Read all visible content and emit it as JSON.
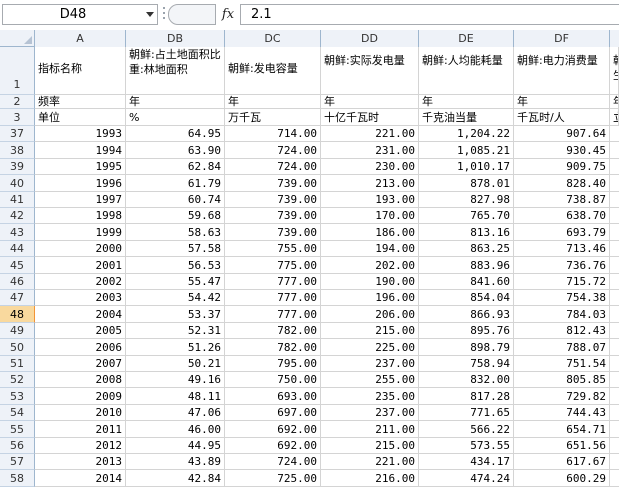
{
  "formula_bar": {
    "cell_ref": "D48",
    "fx_label": "fx",
    "content": "2.1"
  },
  "columns": [
    "A",
    "DB",
    "DC",
    "DD",
    "DE",
    "DF"
  ],
  "header_rows": {
    "row1": {
      "num": "1",
      "A": "指标名称",
      "DB": "朝鲜:占土地面积比重:林地面积",
      "DC": "朝鲜:发电容量",
      "DD": "朝鲜:实际发电量",
      "DE": "朝鲜:人均能耗量",
      "DF": "朝鲜:电力消费量",
      "DG": "朝生"
    },
    "row2": {
      "num": "2",
      "A": "频率",
      "DB": "年",
      "DC": "年",
      "DD": "年",
      "DE": "年",
      "DF": "年",
      "DG": "年"
    },
    "row3": {
      "num": "3",
      "A": "单位",
      "DB": "%",
      "DC": "万千瓦",
      "DD": "十亿千瓦时",
      "DE": "千克油当量",
      "DF": "千瓦时/人",
      "DG": "立"
    }
  },
  "data_rows": [
    {
      "num": "37",
      "A": "1993",
      "DB": "64.95",
      "DC": "714.00",
      "DD": "221.00",
      "DE": "1,204.22",
      "DF": "907.64"
    },
    {
      "num": "38",
      "A": "1994",
      "DB": "63.90",
      "DC": "724.00",
      "DD": "231.00",
      "DE": "1,085.21",
      "DF": "930.45"
    },
    {
      "num": "39",
      "A": "1995",
      "DB": "62.84",
      "DC": "724.00",
      "DD": "230.00",
      "DE": "1,010.17",
      "DF": "909.75"
    },
    {
      "num": "40",
      "A": "1996",
      "DB": "61.79",
      "DC": "739.00",
      "DD": "213.00",
      "DE": "878.01",
      "DF": "828.40"
    },
    {
      "num": "41",
      "A": "1997",
      "DB": "60.74",
      "DC": "739.00",
      "DD": "193.00",
      "DE": "827.98",
      "DF": "738.87"
    },
    {
      "num": "42",
      "A": "1998",
      "DB": "59.68",
      "DC": "739.00",
      "DD": "170.00",
      "DE": "765.70",
      "DF": "638.70"
    },
    {
      "num": "43",
      "A": "1999",
      "DB": "58.63",
      "DC": "739.00",
      "DD": "186.00",
      "DE": "813.16",
      "DF": "693.79"
    },
    {
      "num": "44",
      "A": "2000",
      "DB": "57.58",
      "DC": "755.00",
      "DD": "194.00",
      "DE": "863.25",
      "DF": "713.46"
    },
    {
      "num": "45",
      "A": "2001",
      "DB": "56.53",
      "DC": "775.00",
      "DD": "202.00",
      "DE": "883.96",
      "DF": "736.76"
    },
    {
      "num": "46",
      "A": "2002",
      "DB": "55.47",
      "DC": "777.00",
      "DD": "190.00",
      "DE": "841.60",
      "DF": "715.72"
    },
    {
      "num": "47",
      "A": "2003",
      "DB": "54.42",
      "DC": "777.00",
      "DD": "196.00",
      "DE": "854.04",
      "DF": "754.38"
    },
    {
      "num": "48",
      "A": "2004",
      "DB": "53.37",
      "DC": "777.00",
      "DD": "206.00",
      "DE": "866.93",
      "DF": "784.03",
      "selected": true
    },
    {
      "num": "49",
      "A": "2005",
      "DB": "52.31",
      "DC": "782.00",
      "DD": "215.00",
      "DE": "895.76",
      "DF": "812.43"
    },
    {
      "num": "50",
      "A": "2006",
      "DB": "51.26",
      "DC": "782.00",
      "DD": "225.00",
      "DE": "898.79",
      "DF": "788.07"
    },
    {
      "num": "51",
      "A": "2007",
      "DB": "50.21",
      "DC": "795.00",
      "DD": "237.00",
      "DE": "758.94",
      "DF": "751.54"
    },
    {
      "num": "52",
      "A": "2008",
      "DB": "49.16",
      "DC": "750.00",
      "DD": "255.00",
      "DE": "832.00",
      "DF": "805.85"
    },
    {
      "num": "53",
      "A": "2009",
      "DB": "48.11",
      "DC": "693.00",
      "DD": "235.00",
      "DE": "817.28",
      "DF": "729.82"
    },
    {
      "num": "54",
      "A": "2010",
      "DB": "47.06",
      "DC": "697.00",
      "DD": "237.00",
      "DE": "771.65",
      "DF": "744.43"
    },
    {
      "num": "55",
      "A": "2011",
      "DB": "46.00",
      "DC": "692.00",
      "DD": "211.00",
      "DE": "566.22",
      "DF": "654.71"
    },
    {
      "num": "56",
      "A": "2012",
      "DB": "44.95",
      "DC": "692.00",
      "DD": "215.00",
      "DE": "573.55",
      "DF": "651.56"
    },
    {
      "num": "57",
      "A": "2013",
      "DB": "43.89",
      "DC": "724.00",
      "DD": "221.00",
      "DE": "434.17",
      "DF": "617.67"
    },
    {
      "num": "58",
      "A": "2014",
      "DB": "42.84",
      "DC": "725.00",
      "DD": "216.00",
      "DE": "474.24",
      "DF": "600.29"
    }
  ]
}
